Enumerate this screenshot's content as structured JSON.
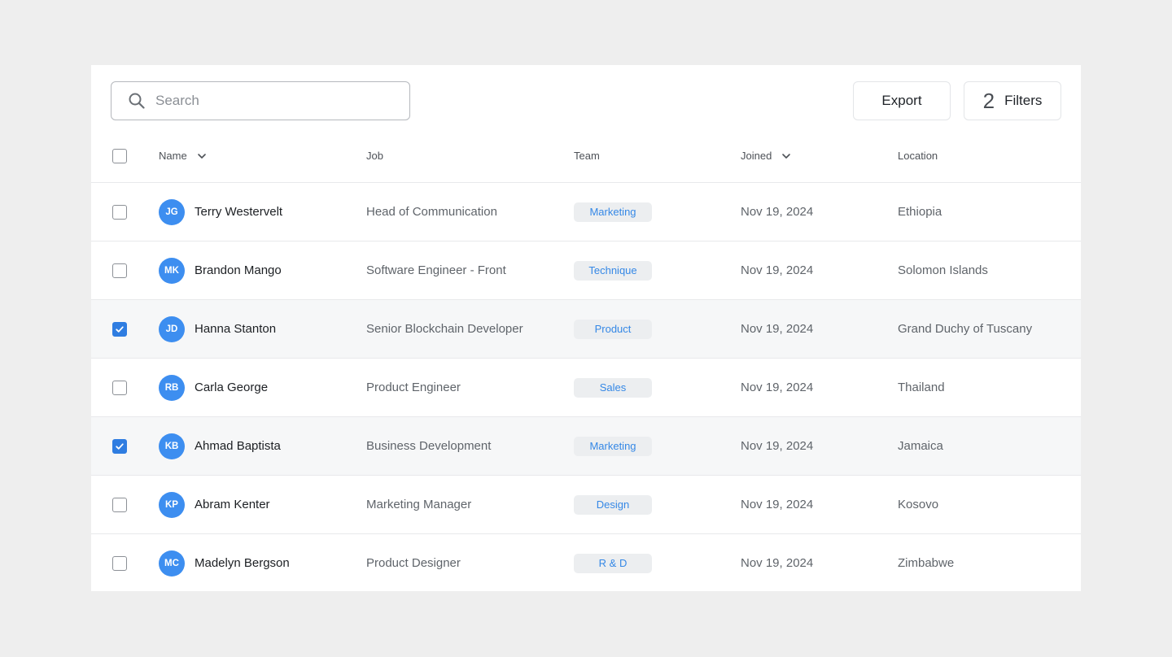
{
  "search": {
    "placeholder": "Search",
    "value": ""
  },
  "toolbar": {
    "export_label": "Export",
    "filters_count": "2",
    "filters_label": "Filters"
  },
  "columns": {
    "name": "Name",
    "job": "Job",
    "team": "Team",
    "joined": "Joined",
    "location": "Location"
  },
  "colors": {
    "accent": "#2f7de1",
    "avatar": "#3d8ef0",
    "badge_text": "#3588e6",
    "selected_row": "#f6f7f8"
  },
  "rows": [
    {
      "initials": "JG",
      "name": "Terry Westervelt",
      "job": "Head of Communication",
      "team": "Marketing",
      "joined": "Nov 19, 2024",
      "location": "Ethiopia",
      "checked": false
    },
    {
      "initials": "MK",
      "name": "Brandon Mango",
      "job": "Software Engineer - Front",
      "team": "Technique",
      "joined": "Nov 19, 2024",
      "location": "Solomon Islands",
      "checked": false
    },
    {
      "initials": "JD",
      "name": "Hanna Stanton",
      "job": "Senior Blockchain Developer",
      "team": "Product",
      "joined": "Nov 19, 2024",
      "location": "Grand Duchy of Tuscany",
      "checked": true
    },
    {
      "initials": "RB",
      "name": "Carla George",
      "job": "Product Engineer",
      "team": "Sales",
      "joined": "Nov 19, 2024",
      "location": "Thailand",
      "checked": false
    },
    {
      "initials": "KB",
      "name": "Ahmad Baptista",
      "job": "Business Development",
      "team": "Marketing",
      "joined": "Nov 19, 2024",
      "location": "Jamaica",
      "checked": true
    },
    {
      "initials": "KP",
      "name": "Abram Kenter",
      "job": "Marketing Manager",
      "team": "Design",
      "joined": "Nov 19, 2024",
      "location": "Kosovo",
      "checked": false
    },
    {
      "initials": "MC",
      "name": "Madelyn Bergson",
      "job": "Product Designer",
      "team": "R & D",
      "joined": "Nov 19, 2024",
      "location": "Zimbabwe",
      "checked": false
    }
  ]
}
